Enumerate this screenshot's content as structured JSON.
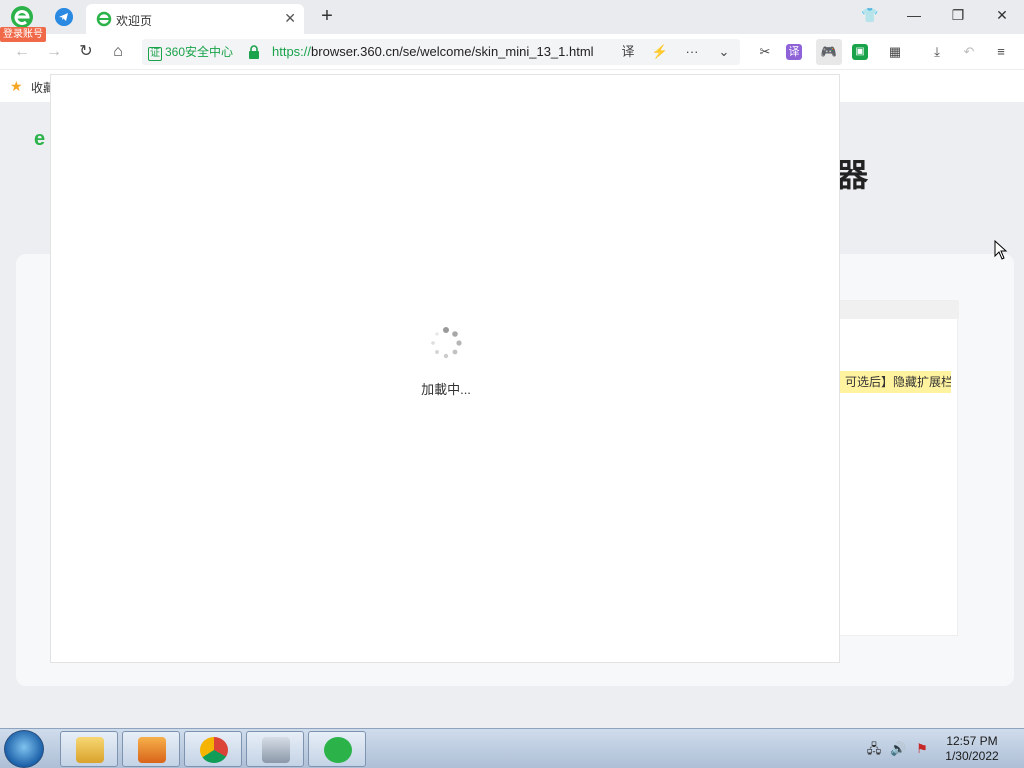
{
  "browser": {
    "login_badge": "登录账号",
    "tab": {
      "title": "欢迎页",
      "close": "✕"
    },
    "new_tab": "+",
    "window_controls": {
      "skin": "👕",
      "minimize": "—",
      "restore": "❐",
      "close": "✕"
    }
  },
  "toolbar": {
    "back": "←",
    "forward": "→",
    "reload": "↻",
    "home": "⌂",
    "security": {
      "cert": "证",
      "label": "360安全中心"
    },
    "url": {
      "scheme": "https://",
      "rest": "browser.360.cn/se/welcome/skin_mini_13_1.html"
    },
    "translate": "译",
    "flash": "⚡",
    "more": "···",
    "dropdown": "⌄",
    "ext_icons": [
      "scissors-icon",
      "translate-icon",
      "game-icon",
      "reader-icon",
      "apps-icon"
    ],
    "ext_translate_label": "译",
    "download": "⤓",
    "undo": "↶",
    "menu": "≡"
  },
  "bookmarks": {
    "label": "收藏"
  },
  "page": {
    "title_partial": "器",
    "preview_tip": "可选后】隐藏扩展栏"
  },
  "popup": {
    "loading_text": "加載中..."
  },
  "taskbar": {
    "apps": [
      "file-explorer-icon",
      "media-player-icon",
      "chrome-icon",
      "tornado-icon",
      "360-browser-icon"
    ],
    "clock": {
      "time": "12:57 PM",
      "date": "1/30/2022"
    }
  },
  "colors": {
    "accent_green": "#1aa34a",
    "badge_red": "#f06a4a"
  }
}
